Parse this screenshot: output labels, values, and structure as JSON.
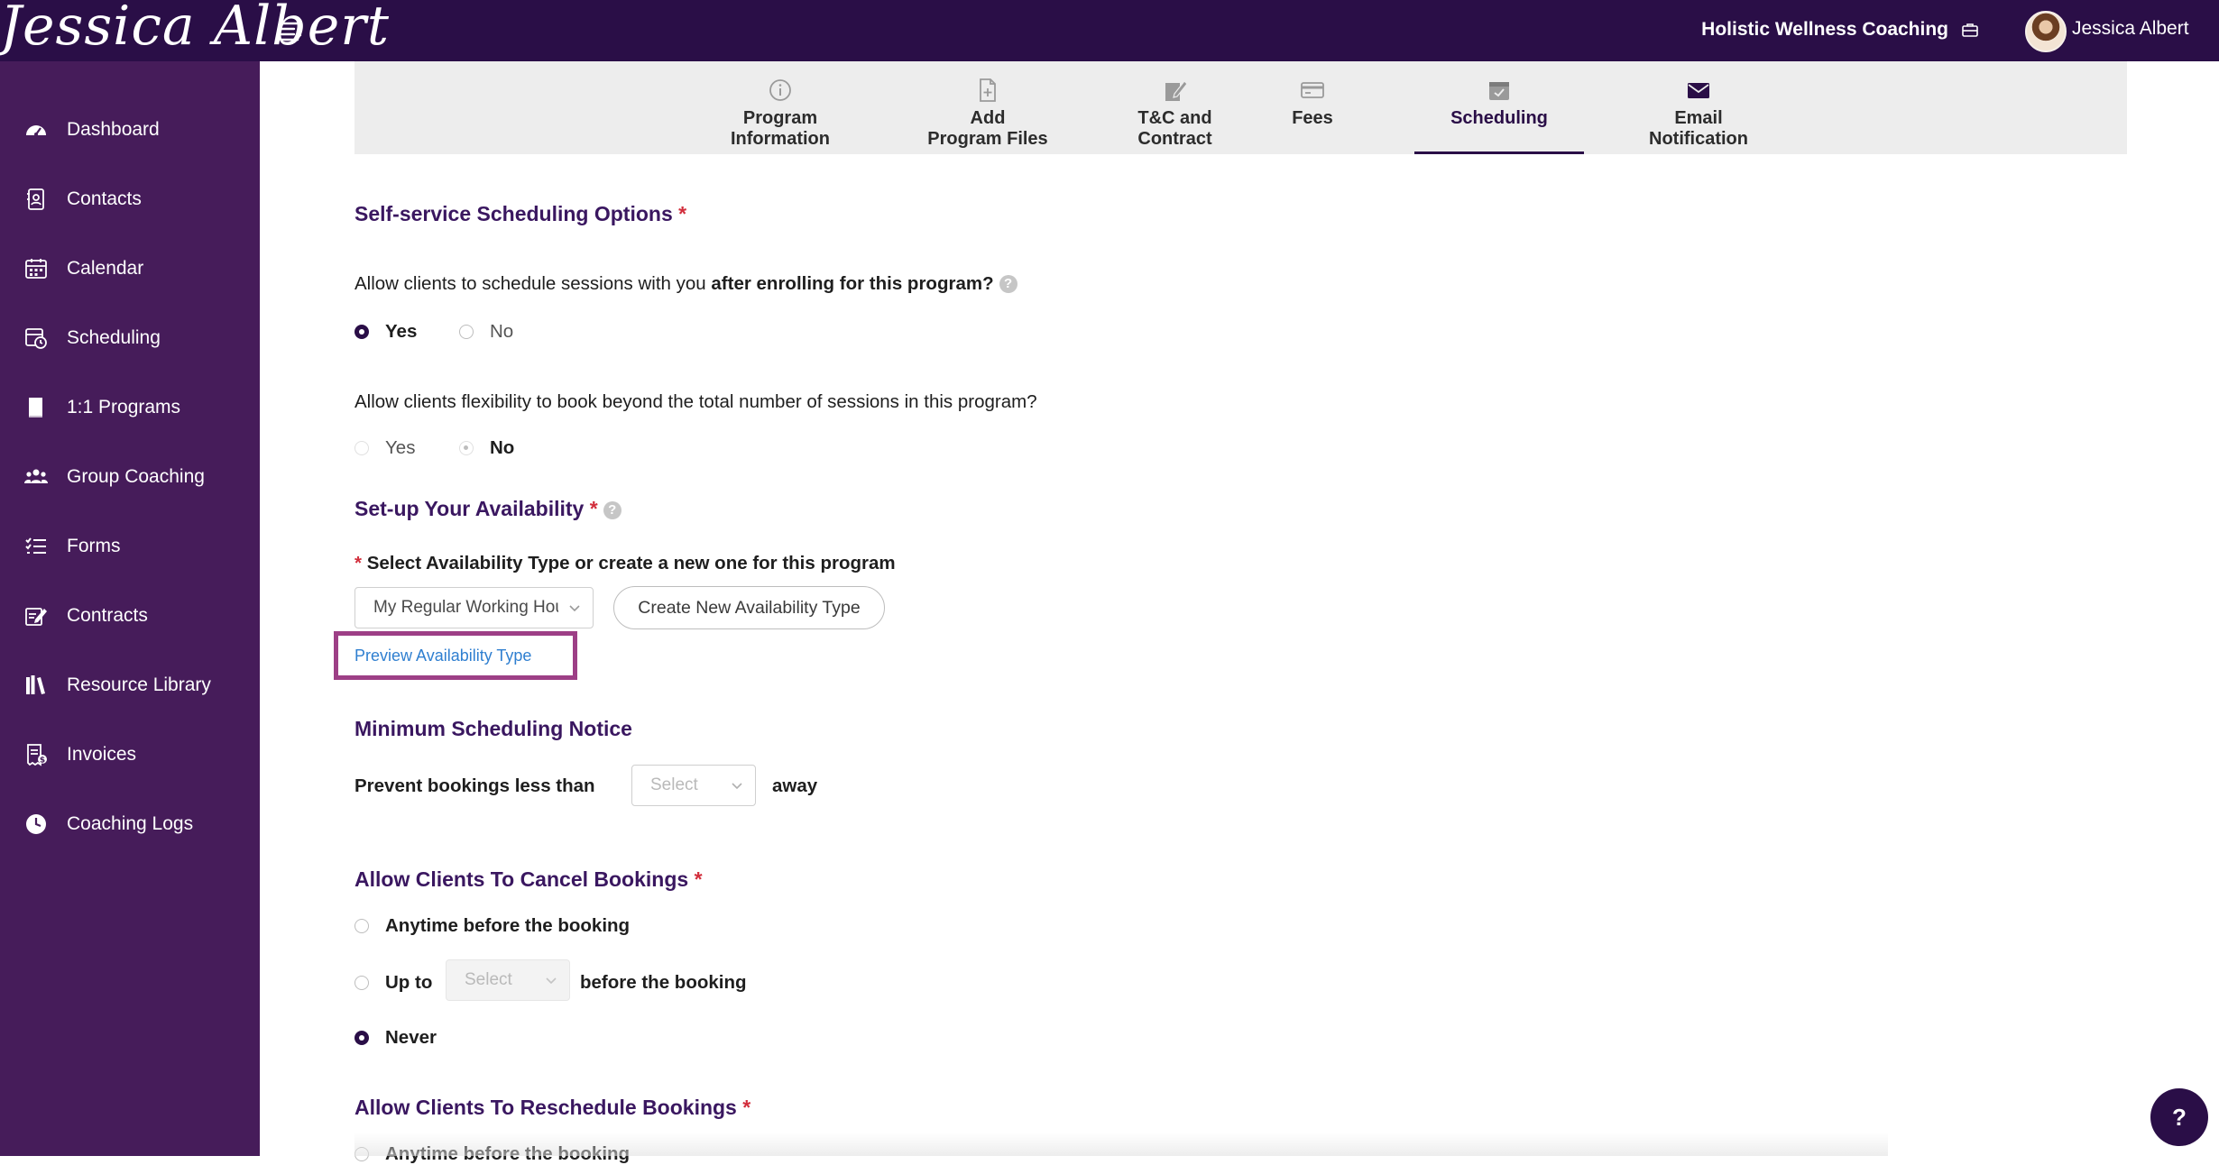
{
  "app": {
    "brand": "Jessica Albert",
    "business_name": "Holistic Wellness Coaching",
    "user_name": "Jessica Albert"
  },
  "sidebar": {
    "items": [
      {
        "label": "Dashboard",
        "icon": "dashboard-icon"
      },
      {
        "label": "Contacts",
        "icon": "contacts-icon"
      },
      {
        "label": "Calendar",
        "icon": "calendar-icon"
      },
      {
        "label": "Scheduling",
        "icon": "scheduling-icon"
      },
      {
        "label": "1:1 Programs",
        "icon": "book-icon"
      },
      {
        "label": "Group Coaching",
        "icon": "group-icon"
      },
      {
        "label": "Forms",
        "icon": "forms-icon"
      },
      {
        "label": "Contracts",
        "icon": "contract-icon"
      },
      {
        "label": "Resource Library",
        "icon": "library-icon"
      },
      {
        "label": "Invoices",
        "icon": "invoice-icon"
      },
      {
        "label": "Coaching Logs",
        "icon": "clock-icon"
      }
    ]
  },
  "tabs": [
    {
      "line1": "Program",
      "line2": "Information",
      "icon": "info-icon"
    },
    {
      "line1": "Add",
      "line2": "Program Files",
      "icon": "file-add-icon"
    },
    {
      "line1": "T&C and",
      "line2": "Contract",
      "icon": "signature-icon"
    },
    {
      "line1": "Fees",
      "line2": "",
      "icon": "card-icon"
    },
    {
      "line1": "Scheduling",
      "line2": "",
      "icon": "calendar-check-icon",
      "active": true
    },
    {
      "line1": "Email",
      "line2": "Notification",
      "icon": "envelope-icon"
    }
  ],
  "self_service": {
    "title": "Self-service Scheduling Options",
    "q1_prefix": "Allow clients to schedule sessions with you ",
    "q1_bold": "after enrolling for this program?",
    "q1_yes": "Yes",
    "q1_no": "No",
    "q1_selected": "Yes",
    "q2": "Allow clients flexibility to book beyond the total number of sessions in this program?",
    "q2_yes": "Yes",
    "q2_no": "No",
    "q2_selected": "No"
  },
  "availability": {
    "title": "Set-up Your Availability",
    "select_label": "Select Availability Type or create a new one for this program",
    "selected_value": "My Regular Working Hours",
    "create_button": "Create New Availability Type",
    "preview_link": "Preview Availability Type"
  },
  "min_notice": {
    "title": "Minimum Scheduling Notice",
    "prefix": "Prevent bookings less than",
    "select_placeholder": "Select",
    "suffix": "away"
  },
  "cancel": {
    "title": "Allow Clients To Cancel Bookings",
    "opt_anytime": "Anytime before the booking",
    "opt_upto_prefix": "Up to",
    "opt_upto_select": "Select",
    "opt_upto_suffix": "before the booking",
    "opt_never": "Never",
    "selected": "Never"
  },
  "reschedule": {
    "title": "Allow Clients To Reschedule Bookings",
    "opt_anytime": "Anytime before the booking"
  },
  "help_button": "?",
  "colors": {
    "topbar": "#2a0e47",
    "sidebar": "#461c5a",
    "section_title": "#3a1760",
    "required": "#d22e3c",
    "link": "#2f7fd0",
    "highlight_box": "#9d3f86"
  }
}
